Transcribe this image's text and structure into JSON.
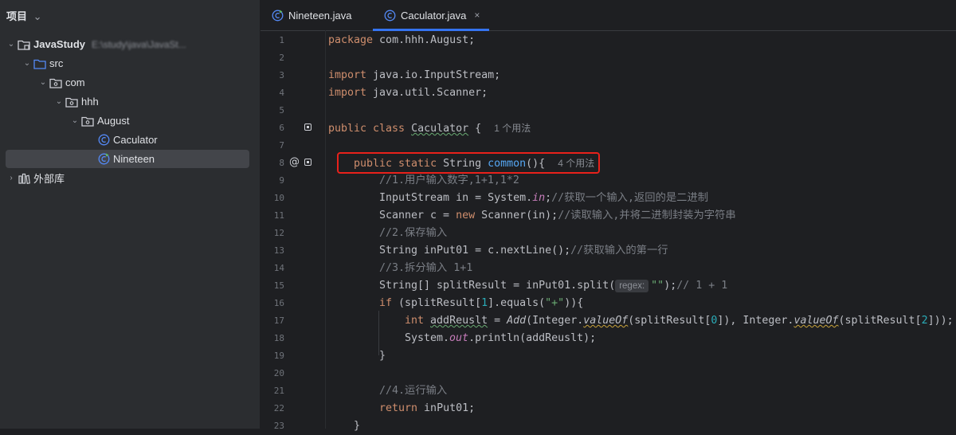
{
  "project_panel": {
    "title": "项目",
    "tree": [
      {
        "label": "JavaStudy",
        "path": "E:\\study\\java\\JavaSt...",
        "kind": "module",
        "level": 0,
        "expanded": true
      },
      {
        "label": "src",
        "kind": "folder",
        "level": 1,
        "expanded": true
      },
      {
        "label": "com",
        "kind": "package",
        "level": 2,
        "expanded": true
      },
      {
        "label": "hhh",
        "kind": "package",
        "level": 3,
        "expanded": true
      },
      {
        "label": "August",
        "kind": "package",
        "level": 4,
        "expanded": true
      },
      {
        "label": "Caculator",
        "kind": "class",
        "level": 5
      },
      {
        "label": "Nineteen",
        "kind": "class-main",
        "level": 5,
        "selected": true
      },
      {
        "label": "外部库",
        "kind": "library",
        "level": 0,
        "expanded": false
      }
    ]
  },
  "tabs": [
    {
      "label": "Nineteen.java",
      "icon": "java-class-main-icon",
      "active": false
    },
    {
      "label": "Caculator.java",
      "icon": "java-class-icon",
      "active": true,
      "close": "×"
    }
  ],
  "editor": {
    "line_numbers": [
      "1",
      "2",
      "3",
      "4",
      "5",
      "6",
      "7",
      "8",
      "9",
      "10",
      "11",
      "12",
      "13",
      "14",
      "15",
      "16",
      "17",
      "18",
      "19",
      "20",
      "21",
      "22",
      "23"
    ],
    "usage_hints": {
      "class": "1 个用法",
      "method": "4 个用法"
    },
    "inlay_regex": "regex:",
    "lines": {
      "l1": {
        "kw": "package",
        "rest": " com.hhh.August;"
      },
      "l3": {
        "kw": "import",
        "rest": " java.io.InputStream;"
      },
      "l4": {
        "kw": "import",
        "rest": " java.util.Scanner;"
      },
      "l6": {
        "kw": "public class",
        "name": "Caculator",
        "rest": " {"
      },
      "l8": {
        "kw": "public static",
        "type": " String ",
        "fn": "common",
        "rest": "(){"
      },
      "l9": "//1.用户输入数字,1+1,1*2",
      "l10": {
        "a": "InputStream in = System.",
        "b": "in",
        "c": ";",
        "cm": "//获取一个输入,返回的是二进制"
      },
      "l11": {
        "a": "Scanner c = ",
        "kw": "new",
        "b": " Scanner(in);",
        "cm": "//读取输入,并将二进制封装为字符串"
      },
      "l12": "//2.保存输入",
      "l13": {
        "a": "String inPut01 = c.nextLine();",
        "cm": "//获取输入的第一行"
      },
      "l14": "//3.拆分输入 1+1",
      "l15": {
        "a": "String[] splitResult = inPut01.split(",
        "str": "\"\"",
        "b": ");",
        "cm": "// 1 + 1"
      },
      "l16": {
        "kw": "if",
        "a": " (splitResult[",
        "n": "1",
        "b": "].equals(",
        "str": "\"+\"",
        "c": ")){"
      },
      "l17": {
        "kw": "int",
        "a": " ",
        "var": "addReuslt",
        "b": " = ",
        "add": "Add",
        "c": "(Integer.",
        "vo1": "valueOf",
        "d": "(splitResult[",
        "n0": "0",
        "e": "]), Integer.",
        "vo2": "valueOf",
        "f": "(splitResult[",
        "n2": "2",
        "g": "]));"
      },
      "l18": {
        "a": "System.",
        "out": "out",
        "b": ".println(addReuslt);"
      },
      "l19": "}",
      "l21": "//4.运行输入",
      "l22": {
        "kw": "return",
        "rest": " inPut01;"
      },
      "l23": "}"
    }
  },
  "colors": {
    "accent": "#3574f0",
    "highlight_box": "#e8211b",
    "keyword": "#cf8e6d",
    "string": "#6aab73",
    "number": "#2aacb8",
    "comment": "#7a7e85",
    "function": "#56a8f5"
  }
}
